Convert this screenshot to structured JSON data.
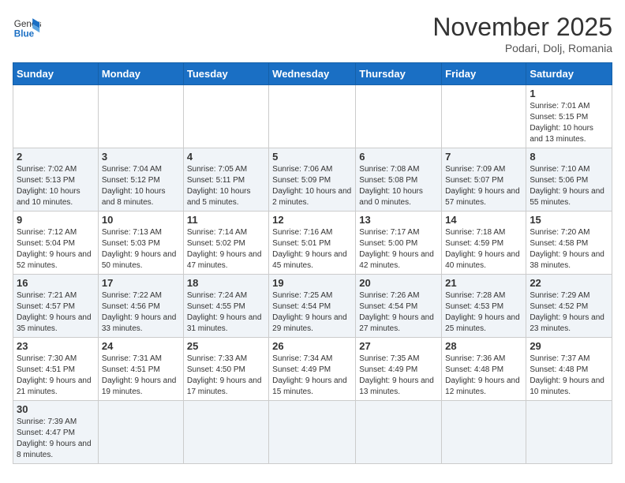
{
  "header": {
    "logo_general": "General",
    "logo_blue": "Blue",
    "month_title": "November 2025",
    "subtitle": "Podari, Dolj, Romania"
  },
  "weekdays": [
    "Sunday",
    "Monday",
    "Tuesday",
    "Wednesday",
    "Thursday",
    "Friday",
    "Saturday"
  ],
  "weeks": [
    [
      {
        "day": "",
        "info": ""
      },
      {
        "day": "",
        "info": ""
      },
      {
        "day": "",
        "info": ""
      },
      {
        "day": "",
        "info": ""
      },
      {
        "day": "",
        "info": ""
      },
      {
        "day": "",
        "info": ""
      },
      {
        "day": "1",
        "info": "Sunrise: 7:01 AM\nSunset: 5:15 PM\nDaylight: 10 hours and 13 minutes."
      }
    ],
    [
      {
        "day": "2",
        "info": "Sunrise: 7:02 AM\nSunset: 5:13 PM\nDaylight: 10 hours and 10 minutes."
      },
      {
        "day": "3",
        "info": "Sunrise: 7:04 AM\nSunset: 5:12 PM\nDaylight: 10 hours and 8 minutes."
      },
      {
        "day": "4",
        "info": "Sunrise: 7:05 AM\nSunset: 5:11 PM\nDaylight: 10 hours and 5 minutes."
      },
      {
        "day": "5",
        "info": "Sunrise: 7:06 AM\nSunset: 5:09 PM\nDaylight: 10 hours and 2 minutes."
      },
      {
        "day": "6",
        "info": "Sunrise: 7:08 AM\nSunset: 5:08 PM\nDaylight: 10 hours and 0 minutes."
      },
      {
        "day": "7",
        "info": "Sunrise: 7:09 AM\nSunset: 5:07 PM\nDaylight: 9 hours and 57 minutes."
      },
      {
        "day": "8",
        "info": "Sunrise: 7:10 AM\nSunset: 5:06 PM\nDaylight: 9 hours and 55 minutes."
      }
    ],
    [
      {
        "day": "9",
        "info": "Sunrise: 7:12 AM\nSunset: 5:04 PM\nDaylight: 9 hours and 52 minutes."
      },
      {
        "day": "10",
        "info": "Sunrise: 7:13 AM\nSunset: 5:03 PM\nDaylight: 9 hours and 50 minutes."
      },
      {
        "day": "11",
        "info": "Sunrise: 7:14 AM\nSunset: 5:02 PM\nDaylight: 9 hours and 47 minutes."
      },
      {
        "day": "12",
        "info": "Sunrise: 7:16 AM\nSunset: 5:01 PM\nDaylight: 9 hours and 45 minutes."
      },
      {
        "day": "13",
        "info": "Sunrise: 7:17 AM\nSunset: 5:00 PM\nDaylight: 9 hours and 42 minutes."
      },
      {
        "day": "14",
        "info": "Sunrise: 7:18 AM\nSunset: 4:59 PM\nDaylight: 9 hours and 40 minutes."
      },
      {
        "day": "15",
        "info": "Sunrise: 7:20 AM\nSunset: 4:58 PM\nDaylight: 9 hours and 38 minutes."
      }
    ],
    [
      {
        "day": "16",
        "info": "Sunrise: 7:21 AM\nSunset: 4:57 PM\nDaylight: 9 hours and 35 minutes."
      },
      {
        "day": "17",
        "info": "Sunrise: 7:22 AM\nSunset: 4:56 PM\nDaylight: 9 hours and 33 minutes."
      },
      {
        "day": "18",
        "info": "Sunrise: 7:24 AM\nSunset: 4:55 PM\nDaylight: 9 hours and 31 minutes."
      },
      {
        "day": "19",
        "info": "Sunrise: 7:25 AM\nSunset: 4:54 PM\nDaylight: 9 hours and 29 minutes."
      },
      {
        "day": "20",
        "info": "Sunrise: 7:26 AM\nSunset: 4:54 PM\nDaylight: 9 hours and 27 minutes."
      },
      {
        "day": "21",
        "info": "Sunrise: 7:28 AM\nSunset: 4:53 PM\nDaylight: 9 hours and 25 minutes."
      },
      {
        "day": "22",
        "info": "Sunrise: 7:29 AM\nSunset: 4:52 PM\nDaylight: 9 hours and 23 minutes."
      }
    ],
    [
      {
        "day": "23",
        "info": "Sunrise: 7:30 AM\nSunset: 4:51 PM\nDaylight: 9 hours and 21 minutes."
      },
      {
        "day": "24",
        "info": "Sunrise: 7:31 AM\nSunset: 4:51 PM\nDaylight: 9 hours and 19 minutes."
      },
      {
        "day": "25",
        "info": "Sunrise: 7:33 AM\nSunset: 4:50 PM\nDaylight: 9 hours and 17 minutes."
      },
      {
        "day": "26",
        "info": "Sunrise: 7:34 AM\nSunset: 4:49 PM\nDaylight: 9 hours and 15 minutes."
      },
      {
        "day": "27",
        "info": "Sunrise: 7:35 AM\nSunset: 4:49 PM\nDaylight: 9 hours and 13 minutes."
      },
      {
        "day": "28",
        "info": "Sunrise: 7:36 AM\nSunset: 4:48 PM\nDaylight: 9 hours and 12 minutes."
      },
      {
        "day": "29",
        "info": "Sunrise: 7:37 AM\nSunset: 4:48 PM\nDaylight: 9 hours and 10 minutes."
      }
    ],
    [
      {
        "day": "30",
        "info": "Sunrise: 7:39 AM\nSunset: 4:47 PM\nDaylight: 9 hours and 8 minutes."
      },
      {
        "day": "",
        "info": ""
      },
      {
        "day": "",
        "info": ""
      },
      {
        "day": "",
        "info": ""
      },
      {
        "day": "",
        "info": ""
      },
      {
        "day": "",
        "info": ""
      },
      {
        "day": "",
        "info": ""
      }
    ]
  ]
}
